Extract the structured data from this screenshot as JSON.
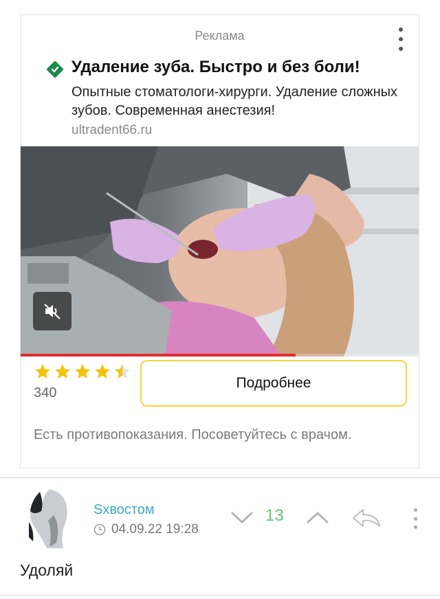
{
  "ad": {
    "label": "Реклама",
    "title": "Удаление зуба. Быстро и без боли!",
    "description": "Опытные стоматологи-хирурги. Удаление сложных зубов. Современная анестезия!",
    "domain": "ultradent66.ru",
    "media": {
      "mute_icon": "speaker-muted-icon",
      "progress": 0.69,
      "progress_color": "#e32b2b"
    },
    "rating_stars": 4.5,
    "rating_count": "340",
    "star_color": "#f4c20d",
    "cta_label": "Подробнее",
    "cta_border_color": "#f5d43a",
    "disclaimer": "Есть противопоказания. Посоветуйтесь с врачом.",
    "favicon_color": "#1a8a4a"
  },
  "comment": {
    "username": "Sxвостом",
    "username_color": "#3aa9c7",
    "clock_icon": "clock-icon",
    "timestamp": "04.09.22 19:28",
    "rating": "13",
    "rating_color": "#6bc27b",
    "text": "Удоляй",
    "icons": {
      "down": "chevron-down-icon",
      "up": "chevron-up-icon",
      "reply": "reply-icon",
      "menu": "more-vertical-icon"
    }
  }
}
